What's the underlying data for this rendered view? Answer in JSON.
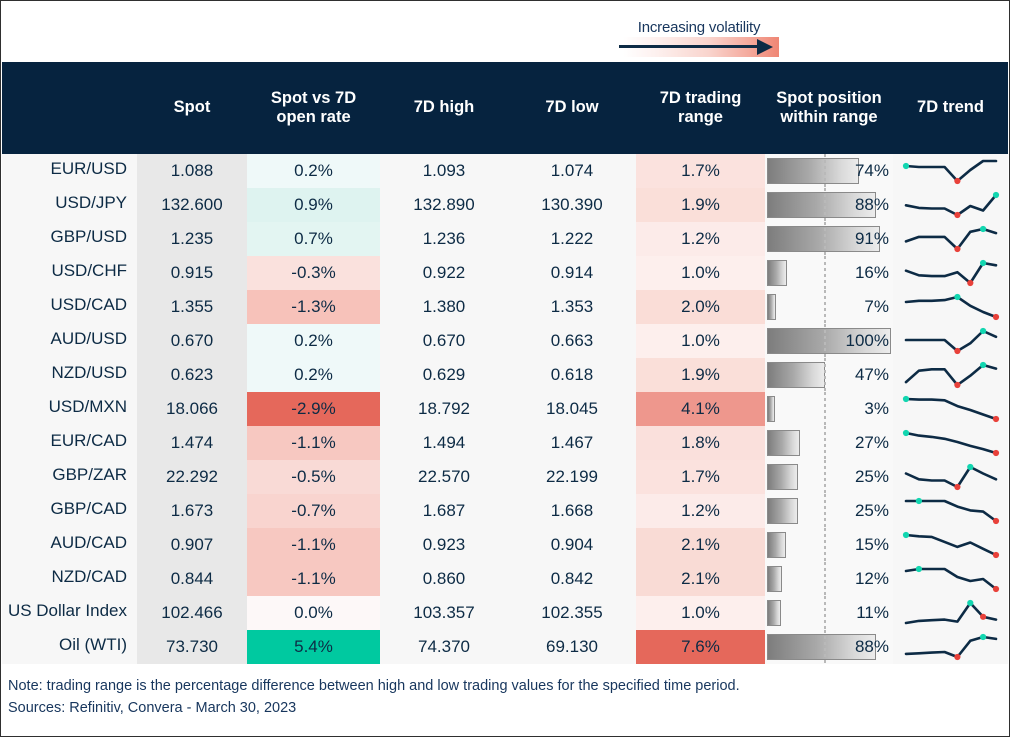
{
  "legend": {
    "label": "Increasing volatility",
    "arrow_icon": "arrow-right-icon",
    "gradient_from": "#ffffff",
    "gradient_to": "#ef8674"
  },
  "table": {
    "columns": [
      {
        "key": "pair",
        "label": ""
      },
      {
        "key": "spot",
        "label": "Spot"
      },
      {
        "key": "chg",
        "label": "Spot vs 7D open rate"
      },
      {
        "key": "high",
        "label": "7D high"
      },
      {
        "key": "low",
        "label": "7D low"
      },
      {
        "key": "range",
        "label": "7D trading range"
      },
      {
        "key": "pos",
        "label": "Spot position within range"
      },
      {
        "key": "trend",
        "label": "7D trend"
      }
    ],
    "header_bg": "#06233f",
    "header_color": "#ffffff",
    "rows": [
      {
        "pair": "EUR/USD",
        "spot": "1.088",
        "chg": "0.2%",
        "chg_val": 0.2,
        "high": "1.093",
        "low": "1.074",
        "range": "1.7%",
        "range_val": 1.7,
        "pos": "74%",
        "pos_val": 74,
        "trend": [
          60,
          58,
          58,
          58,
          30,
          52,
          70,
          70
        ],
        "trend_high_index": 0,
        "trend_low_index": 4
      },
      {
        "pair": "USD/JPY",
        "spot": "132.600",
        "chg": "0.9%",
        "chg_val": 0.9,
        "high": "132.890",
        "low": "130.390",
        "range": "1.9%",
        "range_val": 1.9,
        "pos": "88%",
        "pos_val": 88,
        "trend": [
          48,
          40,
          38,
          38,
          18,
          46,
          32,
          80
        ],
        "trend_high_index": 7,
        "trend_low_index": 4
      },
      {
        "pair": "GBP/USD",
        "spot": "1.235",
        "chg": "0.7%",
        "chg_val": 0.7,
        "high": "1.236",
        "low": "1.222",
        "range": "1.2%",
        "range_val": 1.2,
        "pos": "91%",
        "pos_val": 91,
        "trend": [
          42,
          55,
          55,
          55,
          20,
          70,
          78,
          66
        ],
        "trend_high_index": 6,
        "trend_low_index": 4
      },
      {
        "pair": "USD/CHF",
        "spot": "0.915",
        "chg": "-0.3%",
        "chg_val": -0.3,
        "high": "0.922",
        "low": "0.914",
        "range": "1.0%",
        "range_val": 1.0,
        "pos": "16%",
        "pos_val": 16,
        "trend": [
          52,
          40,
          38,
          38,
          48,
          20,
          72,
          66
        ],
        "trend_high_index": 6,
        "trend_low_index": 5
      },
      {
        "pair": "USD/CAD",
        "spot": "1.355",
        "chg": "-1.3%",
        "chg_val": -1.3,
        "high": "1.380",
        "low": "1.353",
        "range": "2.0%",
        "range_val": 2.0,
        "pos": "7%",
        "pos_val": 7,
        "trend": [
          62,
          66,
          66,
          68,
          78,
          50,
          30,
          14
        ],
        "trend_high_index": 4,
        "trend_low_index": 7
      },
      {
        "pair": "AUD/USD",
        "spot": "0.670",
        "chg": "0.2%",
        "chg_val": 0.2,
        "high": "0.670",
        "low": "0.663",
        "range": "1.0%",
        "range_val": 1.0,
        "pos": "100%",
        "pos_val": 100,
        "trend": [
          58,
          58,
          58,
          58,
          24,
          48,
          86,
          68
        ],
        "trend_high_index": 6,
        "trend_low_index": 4
      },
      {
        "pair": "NZD/USD",
        "spot": "0.623",
        "chg": "0.2%",
        "chg_val": 0.2,
        "high": "0.629",
        "low": "0.618",
        "range": "1.9%",
        "range_val": 1.9,
        "pos": "47%",
        "pos_val": 47,
        "trend": [
          34,
          66,
          70,
          70,
          26,
          52,
          82,
          72
        ],
        "trend_high_index": 6,
        "trend_low_index": 4
      },
      {
        "pair": "USD/MXN",
        "spot": "18.066",
        "chg": "-2.9%",
        "chg_val": -2.9,
        "high": "18.792",
        "low": "18.045",
        "range": "4.1%",
        "range_val": 4.1,
        "pos": "3%",
        "pos_val": 3,
        "trend": [
          78,
          76,
          76,
          74,
          56,
          44,
          30,
          16
        ],
        "trend_high_index": 0,
        "trend_low_index": 7
      },
      {
        "pair": "EUR/CAD",
        "spot": "1.474",
        "chg": "-1.1%",
        "chg_val": -1.1,
        "high": "1.494",
        "low": "1.467",
        "range": "1.8%",
        "range_val": 1.8,
        "pos": "27%",
        "pos_val": 27,
        "trend": [
          80,
          72,
          68,
          62,
          52,
          40,
          30,
          18
        ],
        "trend_high_index": 0,
        "trend_low_index": 7
      },
      {
        "pair": "GBP/ZAR",
        "spot": "22.292",
        "chg": "-0.5%",
        "chg_val": -0.5,
        "high": "22.570",
        "low": "22.199",
        "range": "1.7%",
        "range_val": 1.7,
        "pos": "25%",
        "pos_val": 25,
        "trend": [
          58,
          40,
          36,
          36,
          16,
          78,
          58,
          40
        ],
        "trend_high_index": 5,
        "trend_low_index": 4
      },
      {
        "pair": "GBP/CAD",
        "spot": "1.673",
        "chg": "-0.7%",
        "chg_val": -0.7,
        "high": "1.687",
        "low": "1.668",
        "range": "1.2%",
        "range_val": 1.2,
        "pos": "25%",
        "pos_val": 25,
        "trend": [
          80,
          80,
          80,
          80,
          62,
          50,
          46,
          16
        ],
        "trend_high_index": 1,
        "trend_low_index": 7
      },
      {
        "pair": "AUD/CAD",
        "spot": "0.907",
        "chg": "-1.1%",
        "chg_val": -1.1,
        "high": "0.923",
        "low": "0.904",
        "range": "2.1%",
        "range_val": 2.1,
        "pos": "15%",
        "pos_val": 15,
        "trend": [
          78,
          74,
          72,
          56,
          40,
          54,
          34,
          14
        ],
        "trend_high_index": 0,
        "trend_low_index": 7
      },
      {
        "pair": "NZD/CAD",
        "spot": "0.844",
        "chg": "-1.1%",
        "chg_val": -1.1,
        "high": "0.860",
        "low": "0.842",
        "range": "2.1%",
        "range_val": 2.1,
        "pos": "12%",
        "pos_val": 12,
        "trend": [
          70,
          76,
          76,
          76,
          52,
          40,
          46,
          16
        ],
        "trend_high_index": 1,
        "trend_low_index": 7
      },
      {
        "pair": "US Dollar Index",
        "spot": "102.466",
        "chg": "0.0%",
        "chg_val": 0.0,
        "high": "103.357",
        "low": "102.355",
        "range": "1.0%",
        "range_val": 1.0,
        "pos": "11%",
        "pos_val": 11,
        "trend": [
          26,
          32,
          34,
          36,
          30,
          84,
          44,
          36
        ],
        "trend_high_index": 5,
        "trend_low_index": 6
      },
      {
        "pair": "Oil (WTI)",
        "spot": "73.730",
        "chg": "5.4%",
        "chg_val": 5.4,
        "high": "74.370",
        "low": "69.130",
        "range": "7.6%",
        "range_val": 7.6,
        "pos": "88%",
        "pos_val": 88,
        "trend": [
          26,
          28,
          30,
          32,
          16,
          68,
          80,
          74
        ],
        "trend_high_index": 6,
        "trend_low_index": 4
      }
    ]
  },
  "colors": {
    "positive_strong": "#00c9a0",
    "positive_light": "#d6f0ec",
    "negative_strong": "#e5685b",
    "negative_light": "#fbeae8",
    "range_strong": "#e5685b",
    "range_light": "#fdf1ef",
    "spot_bg": "#e8e8e8",
    "row_bg": "#f7f7f7",
    "spark_line": "#0d2b45",
    "spark_high": "#12d6b0",
    "spark_low": "#e8413a",
    "text": "#0d2b45"
  },
  "footer": {
    "note": "Note: trading range is the percentage difference between high and low trading values for the specified time period.",
    "sources": "Sources: Refinitiv, Convera - March 30, 2023"
  }
}
